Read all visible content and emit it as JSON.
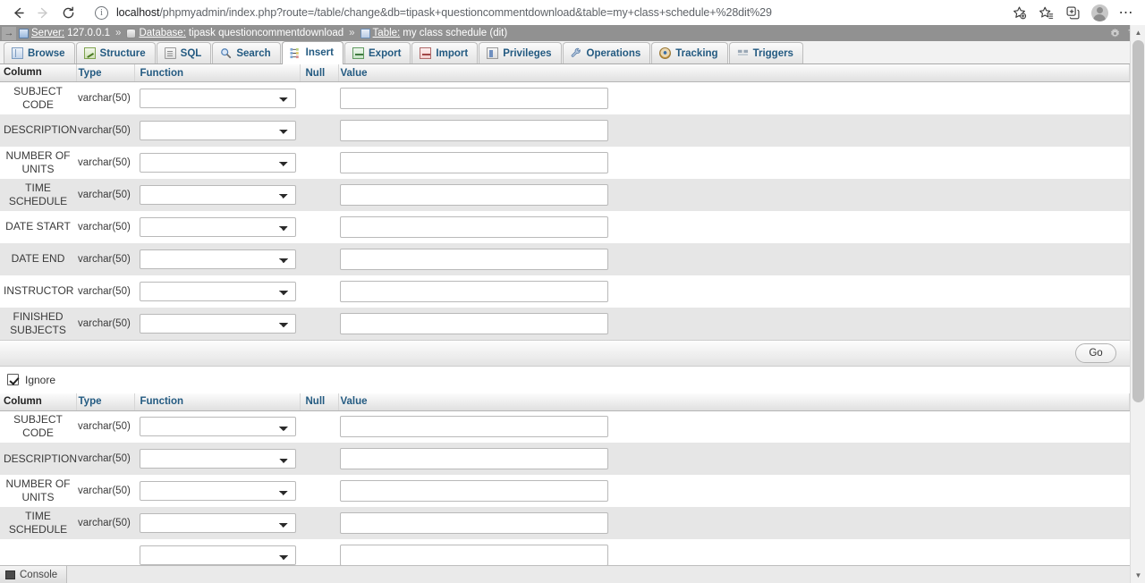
{
  "browser": {
    "back_label": "Back",
    "forward_label": "Forward",
    "reload_label": "Reload",
    "url_host": "localhost",
    "url_path": "/phpmyadmin/index.php?route=/table/change&db=tipask+questioncommentdownload&table=my+class+schedule+%28dit%29",
    "url_full": "localhost/phpmyadmin/index.php?route=/table/change&db=tipask+questioncommentdownload&table=my+class+schedule+%28dit%29",
    "icons": {
      "info": "info-icon",
      "add_favorite": "add-favorite-star-icon",
      "favorites": "favorites-icon",
      "split_screen": "split-screen-icon",
      "profile": "profile-avatar-icon",
      "settings_more": "more-options-icon"
    }
  },
  "breadcrumb": {
    "collapse_arrow": "→",
    "server_label": "Server:",
    "server_value": "127.0.0.1",
    "database_label": "Database:",
    "database_value": "tipask questioncommentdownload",
    "table_label": "Table:",
    "table_value": "my class schedule (dit)",
    "separator": "»",
    "right_icons": [
      "gear-icon",
      "collapse-up-icon"
    ]
  },
  "tabs": [
    {
      "label": "Browse",
      "icon": "browse-icon",
      "active": false
    },
    {
      "label": "Structure",
      "icon": "structure-icon",
      "active": false
    },
    {
      "label": "SQL",
      "icon": "sql-icon",
      "active": false
    },
    {
      "label": "Search",
      "icon": "search-icon",
      "active": false
    },
    {
      "label": "Insert",
      "icon": "insert-icon",
      "active": true
    },
    {
      "label": "Export",
      "icon": "export-icon",
      "active": false
    },
    {
      "label": "Import",
      "icon": "import-icon",
      "active": false
    },
    {
      "label": "Privileges",
      "icon": "privileges-icon",
      "active": false
    },
    {
      "label": "Operations",
      "icon": "operations-icon",
      "active": false
    },
    {
      "label": "Tracking",
      "icon": "tracking-icon",
      "active": false
    },
    {
      "label": "Triggers",
      "icon": "triggers-icon",
      "active": false
    }
  ],
  "table_headers": {
    "column": "Column",
    "type": "Type",
    "function": "Function",
    "null": "Null",
    "value": "Value"
  },
  "form_rows": [
    {
      "column": "SUBJECT CODE",
      "type": "varchar(50)",
      "function": "",
      "null": "",
      "value": ""
    },
    {
      "column": "DESCRIPTION",
      "type": "varchar(50)",
      "function": "",
      "null": "",
      "value": ""
    },
    {
      "column": "NUMBER OF UNITS",
      "type": "varchar(50)",
      "function": "",
      "null": "",
      "value": ""
    },
    {
      "column": "TIME SCHEDULE",
      "type": "varchar(50)",
      "function": "",
      "null": "",
      "value": ""
    },
    {
      "column": "DATE START",
      "type": "varchar(50)",
      "function": "",
      "null": "",
      "value": ""
    },
    {
      "column": "DATE END",
      "type": "varchar(50)",
      "function": "",
      "null": "",
      "value": ""
    },
    {
      "column": "INSTRUCTOR",
      "type": "varchar(50)",
      "function": "",
      "null": "",
      "value": ""
    },
    {
      "column": "FINISHED SUBJECTS",
      "type": "varchar(50)",
      "function": "",
      "null": "",
      "value": ""
    }
  ],
  "second_form_rows": [
    {
      "column": "SUBJECT CODE",
      "type": "varchar(50)",
      "function": "",
      "null": "",
      "value": ""
    },
    {
      "column": "DESCRIPTION",
      "type": "varchar(50)",
      "function": "",
      "null": "",
      "value": ""
    },
    {
      "column": "NUMBER OF UNITS",
      "type": "varchar(50)",
      "function": "",
      "null": "",
      "value": ""
    },
    {
      "column": "TIME SCHEDULE",
      "type": "varchar(50)",
      "function": "",
      "null": "",
      "value": ""
    }
  ],
  "actions": {
    "go_label": "Go",
    "ignore_label": "Ignore",
    "ignore_checked": true
  },
  "console": {
    "label": "Console",
    "icon": "console-icon"
  },
  "colors": {
    "tab_link": "#235a81",
    "breadcrumb_bg": "#919191",
    "row_alt_bg": "#e6e6e6",
    "scrollbar_thumb": "#c1c1c1"
  }
}
